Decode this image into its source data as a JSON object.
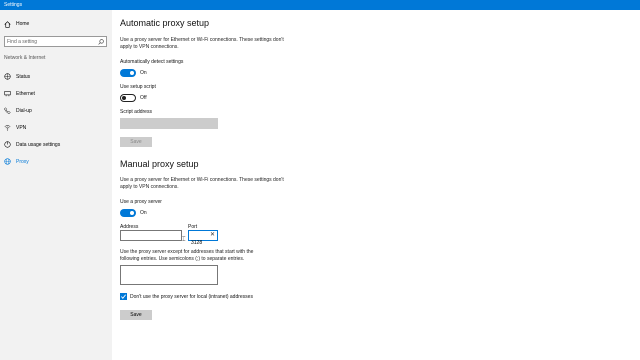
{
  "window": {
    "title": "Settings"
  },
  "sidebar": {
    "home_label": "Home",
    "search_placeholder": "Find a setting",
    "section_label": "Network & Internet",
    "items": [
      {
        "label": "Status",
        "icon": "globe-icon"
      },
      {
        "label": "Ethernet",
        "icon": "ethernet-icon"
      },
      {
        "label": "Dial-up",
        "icon": "phone-icon"
      },
      {
        "label": "VPN",
        "icon": "vpn-icon"
      },
      {
        "label": "Data usage settings",
        "icon": "data-usage-icon"
      },
      {
        "label": "Proxy",
        "icon": "proxy-globe-icon",
        "active": true
      }
    ]
  },
  "automatic": {
    "heading": "Automatic proxy setup",
    "description": "Use a proxy server for Ethernet or Wi-Fi connections. These settings don't apply to VPN connections.",
    "detect_label": "Automatically detect settings",
    "detect_state": "On",
    "script_label": "Use setup script",
    "script_state": "Off",
    "script_address_label": "Script address",
    "script_address_value": "",
    "save_label": "Save"
  },
  "manual": {
    "heading": "Manual proxy setup",
    "description": "Use a proxy server for Ethernet or Wi-Fi connections. These settings don't apply to VPN connections.",
    "use_proxy_label": "Use a proxy server",
    "use_proxy_state": "On",
    "address_label": "Address",
    "address_value": "",
    "port_label": "Port",
    "port_value": "3128",
    "exceptions_description": "Use the proxy server except for addresses that start with the following entries. Use semicolons (;) to separate entries.",
    "exceptions_value": "",
    "local_checkbox_label": "Don't use the proxy server for local (intranet) addresses",
    "local_checked": true,
    "save_label": "Save"
  },
  "colors": {
    "accent": "#0078d7",
    "sidebar_bg": "#f2f2f2"
  }
}
